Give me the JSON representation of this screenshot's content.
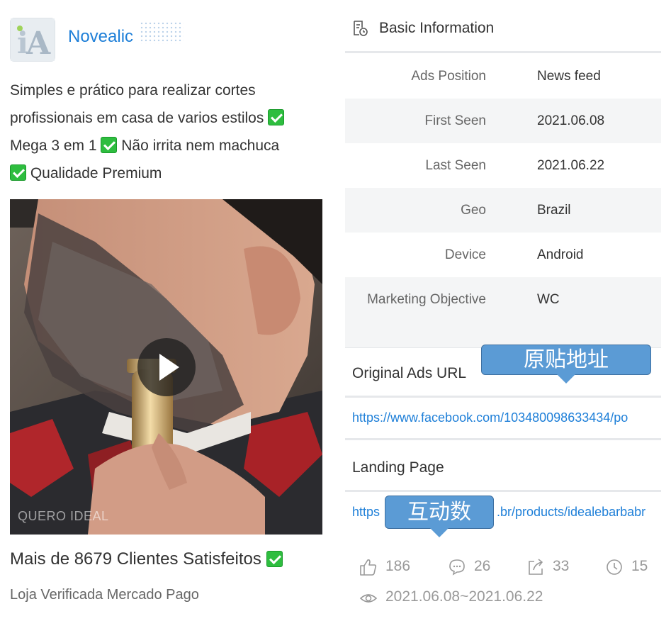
{
  "advertiser": {
    "page_name": "Novealic",
    "avatar_icon": "ia-logo"
  },
  "ad": {
    "text_line1": "Simples e prático para realizar cortes",
    "text_line2": "profissionais em casa de varios estilos",
    "text_line3a": "Mega 3 em 1",
    "text_line3b": "Não irrita nem machuca",
    "text_line4": "Qualidade Premium",
    "check_icon": "green-check-emoji",
    "watermark": "QUERO IDEAL",
    "headline": "Mais de 8679 Clientes Satisfeitos",
    "description": "Loja Verificada Mercado Pago"
  },
  "info": {
    "section_title": "Basic Information",
    "rows": [
      {
        "label": "Ads Position",
        "value": "News feed"
      },
      {
        "label": "First Seen",
        "value": "2021.06.08"
      },
      {
        "label": "Last Seen",
        "value": "2021.06.22"
      },
      {
        "label": "Geo",
        "value": "Brazil"
      },
      {
        "label": "Device",
        "value": "Android"
      },
      {
        "label": "Marketing Objective",
        "value": "WC"
      }
    ]
  },
  "original_ads": {
    "title": "Original Ads URL",
    "url": "https://www.facebook.com/103480098633434/po"
  },
  "landing": {
    "title": "Landing Page",
    "url_start": "https",
    "url_end": ".br/products/idealebarbabr"
  },
  "stats": {
    "likes": "186",
    "comments": "26",
    "shares": "33",
    "duration": "15"
  },
  "date_range": "2021.06.08~2021.06.22",
  "callouts": {
    "original_url": "原贴地址",
    "engagement": "互动数"
  },
  "colors": {
    "link": "#1e7fd8",
    "callout": "#5b9bd5",
    "check": "#2ebd3f"
  }
}
